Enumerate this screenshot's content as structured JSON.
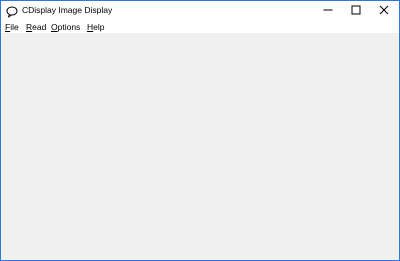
{
  "window": {
    "title": "CDisplay Image Display",
    "icon": "speech-bubble-icon"
  },
  "caption_buttons": {
    "minimize": "minimize-icon",
    "maximize": "maximize-icon",
    "close": "close-icon"
  },
  "menu": {
    "file": {
      "accel": "F",
      "rest": "ile"
    },
    "read": {
      "accel": "R",
      "rest": "ead"
    },
    "options": {
      "accel": "O",
      "rest": "ptions"
    },
    "help": {
      "accel": "H",
      "rest": "elp"
    }
  },
  "colors": {
    "border": "#2b79d8",
    "client_background": "#f0f0f0",
    "titlebar_background": "#ffffff"
  }
}
